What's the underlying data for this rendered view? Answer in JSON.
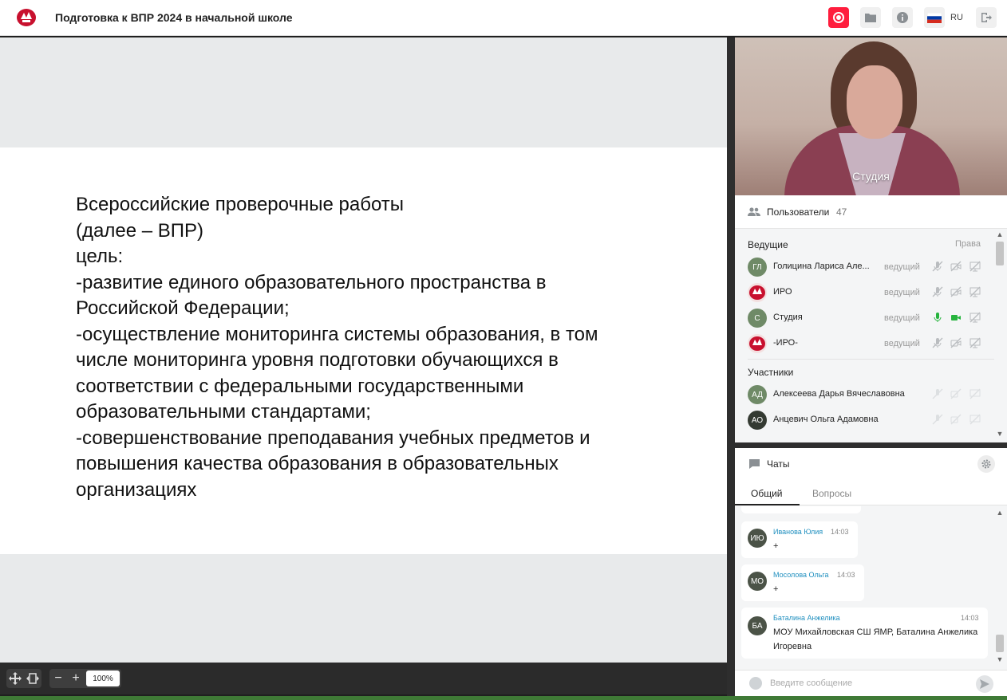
{
  "header": {
    "title": "Подготовка к ВПР 2024 в начальной школе",
    "language": "RU"
  },
  "slide": {
    "lines": [
      "Всероссийские проверочные работы",
      "(далее – ВПР)",
      "цель:",
      "-развитие единого образовательного пространства в",
      "Российской Федерации;",
      "-осуществление мониторинга системы образования, в том",
      "числе мониторинга уровня подготовки обучающихся в",
      "соответствии с федеральными государственными",
      "образовательными стандартами;",
      "-совершенствование преподавания учебных предметов и",
      "повышения качества образования в образовательных",
      "организациях"
    ]
  },
  "toolbar": {
    "zoom": "100%",
    "zoom_out": "−",
    "zoom_in": "+"
  },
  "video": {
    "label": "Студия"
  },
  "users": {
    "title": "Пользователи",
    "count": "47",
    "hosts_label": "Ведущие",
    "rights_label": "Права",
    "participants_label": "Участники",
    "hosts": [
      {
        "initials": "ГЛ",
        "name": "Голицина Лариса Але...",
        "role": "ведущий",
        "avatar": "initials",
        "mic": "off",
        "cam": "off"
      },
      {
        "initials": "",
        "name": "ИРО",
        "role": "ведущий",
        "avatar": "logo",
        "mic": "off",
        "cam": "off"
      },
      {
        "initials": "С",
        "name": "Студия",
        "role": "ведущий",
        "avatar": "initials",
        "mic": "on",
        "cam": "on"
      },
      {
        "initials": "",
        "name": "-ИРО-",
        "role": "ведущий",
        "avatar": "logo",
        "mic": "off",
        "cam": "off"
      }
    ],
    "participants": [
      {
        "initials": "АД",
        "name": "Алексеева Дарья Вячеславовна"
      },
      {
        "initials": "АО",
        "name": "Анцевич Ольга Адамовна"
      }
    ]
  },
  "chat": {
    "title": "Чаты",
    "tabs": [
      "Общий",
      "Вопросы"
    ],
    "placeholder": "Введите сообщение",
    "messages": [
      {
        "initials": "ИЮ",
        "author": "Иванова Юлия",
        "time": "14:03",
        "text": "+"
      },
      {
        "initials": "МО",
        "author": "Мосолова Ольга",
        "time": "14:03",
        "text": "+"
      },
      {
        "initials": "БА",
        "author": "Баталина Анжелика",
        "time": "14:03",
        "text": "МОУ Михайловская СШ ЯМР, Баталина Анжелика Игоревна"
      }
    ]
  },
  "colors": {
    "record": "#ff1d3d",
    "link": "#1f8fbf",
    "mic_on": "#27b43e",
    "avatar_dark": "#4b5347",
    "avatar_green": "#6f8a67"
  },
  "icons": [
    "logo-icon",
    "record-icon",
    "folder-icon",
    "info-icon",
    "flag-ru-icon",
    "exit-icon",
    "move-icon",
    "fit-icon",
    "users-icon",
    "mic-icon",
    "camera-icon",
    "screen-share-icon",
    "chat-icon",
    "gear-icon",
    "emoji-icon",
    "send-icon"
  ]
}
